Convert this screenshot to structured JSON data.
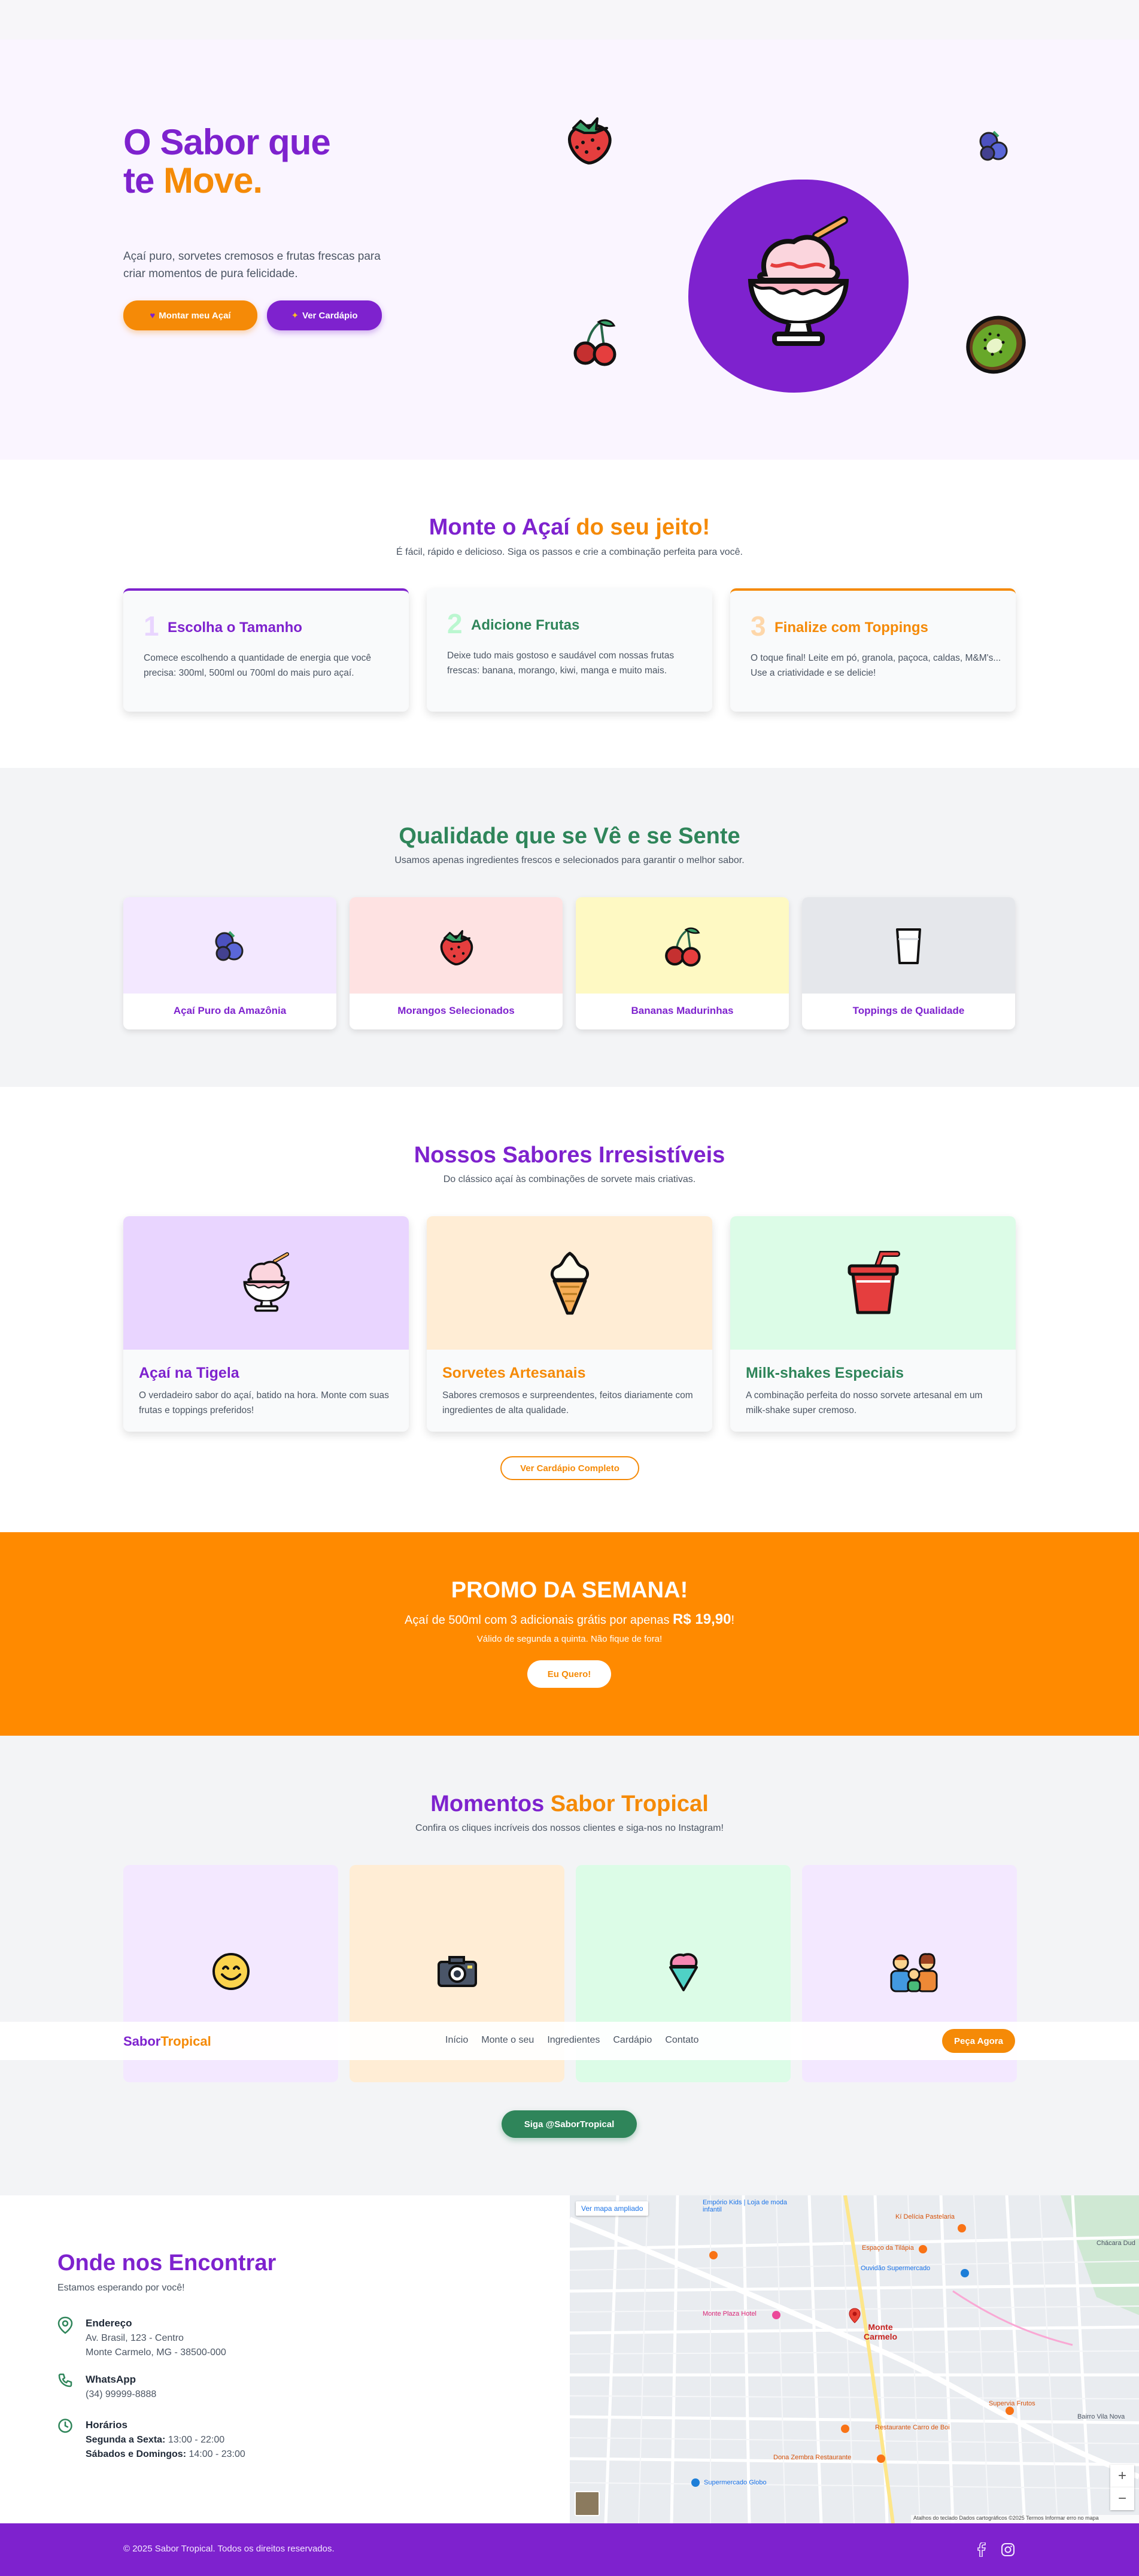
{
  "colors": {
    "brand_purple": "#7e22ce",
    "brand_orange": "#f97316",
    "accent_green": "#2f855a",
    "promo_bg": "#ff8a00"
  },
  "hero": {
    "title_line1": "O Sabor que",
    "title_line2_a": "te ",
    "title_line2_b": "Move",
    "title_line2_c": ".",
    "subtitle": "Açaí puro, sorvetes cremosos e frutas frescas para criar momentos de pura felicidade.",
    "btn_build": "Montar meu Açaí",
    "btn_menu": "Ver Cardápio",
    "btn_build_icon": "purple-heart",
    "btn_menu_icon": "sparkle"
  },
  "build": {
    "title_a": "Monte o Açaí",
    "title_b": "do seu jeito!",
    "subtitle": "É fácil, rápido e delicioso. Siga os passos e crie a combinação perfeita para você.",
    "steps": [
      {
        "num": "1",
        "title": "Escolha o Tamanho",
        "desc": "Comece escolhendo a quantidade de energia que você precisa: 300ml, 500ml ou 700ml do mais puro açaí."
      },
      {
        "num": "2",
        "title": "Adicione Frutas",
        "desc": "Deixe tudo mais gostoso e saudável com nossas frutas frescas: banana, morango, kiwi, manga e muito mais."
      },
      {
        "num": "3",
        "title": "Finalize com Toppings",
        "desc": "O toque final! Leite em pó, granola, paçoca, caldas, M&M's... Use a criatividade e se delicie!"
      }
    ]
  },
  "quality": {
    "title": "Qualidade que se Vê e se Sente",
    "subtitle": "Usamos apenas ingredientes frescos e selecionados para garantir o melhor sabor.",
    "items": [
      {
        "label": "Açaí Puro da Amazônia",
        "icon": "blueberries-icon"
      },
      {
        "label": "Morangos Selecionados",
        "icon": "strawberry-icon"
      },
      {
        "label": "Bananas Madurinhas",
        "icon": "cherries-icon"
      },
      {
        "label": "Toppings de Qualidade",
        "icon": "glass-icon"
      }
    ]
  },
  "flavors": {
    "title": "Nossos Sabores Irresistíveis",
    "subtitle": "Do clássico açaí às combinações de sorvete mais criativas.",
    "items": [
      {
        "title": "Açaí na Tigela",
        "desc": "O verdadeiro sabor do açaí, batido na hora. Monte com suas frutas e toppings preferidos!",
        "icon": "shaved-ice-icon"
      },
      {
        "title": "Sorvetes Artesanais",
        "desc": "Sabores cremosos e surpreendentes, feitos diariamente com ingredientes de alta qualidade.",
        "icon": "soft-ice-cream-icon"
      },
      {
        "title": "Milk-shakes Especiais",
        "desc": "A combinação perfeita do nosso sorvete artesanal em um milk-shake super cremoso.",
        "icon": "cup-with-straw-icon"
      }
    ],
    "cta": "Ver Cardápio Completo"
  },
  "promo": {
    "title": "PROMO DA SEMANA!",
    "line_a": "Açaí de 500ml com 3 adicionais grátis por apenas ",
    "price": "R$ 19,90",
    "line_b": "!",
    "note": "Válido de segunda a quinta. Não fique de fora!",
    "cta": "Eu Quero!"
  },
  "moments": {
    "title_a": "Momentos",
    "title_b": "Sabor Tropical",
    "subtitle": "Confira os cliques incríveis dos nossos clientes e siga-nos no Instagram!",
    "cta": "Siga @SaborTropical",
    "items": [
      {
        "icon": "smiling-face-icon"
      },
      {
        "icon": "camera-icon"
      },
      {
        "icon": "shaved-ice-icon"
      },
      {
        "icon": "family-icon"
      }
    ]
  },
  "nav": {
    "logo_a": "Sabor",
    "logo_b": "Tropical",
    "links": [
      "Início",
      "Monte o seu",
      "Ingredientes",
      "Cardápio",
      "Contato"
    ],
    "cta": "Peça Agora"
  },
  "location": {
    "title": "Onde nos Encontrar",
    "subtitle": "Estamos esperando por você!",
    "address_label": "Endereço",
    "address_line1": "Av. Brasil, 123 - Centro",
    "address_line2": "Monte Carmelo, MG - 38500-000",
    "whatsapp_label": "WhatsApp",
    "whatsapp": "(34) 99999-8888",
    "hours_label": "Horários",
    "hours_weekdays_label": "Segunda a Sexta:",
    "hours_weekdays": " 13:00 - 22:00",
    "hours_weekend_label": "Sábados e Domingos:",
    "hours_weekend": " 14:00 - 23:00"
  },
  "map": {
    "view_larger": "Ver mapa ampliado",
    "city": "Monte Carmelo",
    "labels": [
      "Empório Kids | Loja de moda infantil",
      "Kí Delícia Pastelaria",
      "Espaço da Tilápia",
      "Ouvidão Supermercado",
      "Monte Plaza Hotel",
      "Restaurante Carro de Boi",
      "Supermercado Globo",
      "Dona Zembra Restaurante",
      "Chácara Dud",
      "Bairro Vila Nova",
      "Supervia Frutos"
    ],
    "attribution": "Atalhos do teclado   Dados cartográficos ©2025   Termos   Informar erro no mapa",
    "zoom_in": "+",
    "zoom_out": "−"
  },
  "footer": {
    "copyright": "© 2025 Sabor Tropical. Todos os direitos reservados.",
    "facebook_icon": "facebook-icon",
    "instagram_icon": "instagram-icon"
  }
}
